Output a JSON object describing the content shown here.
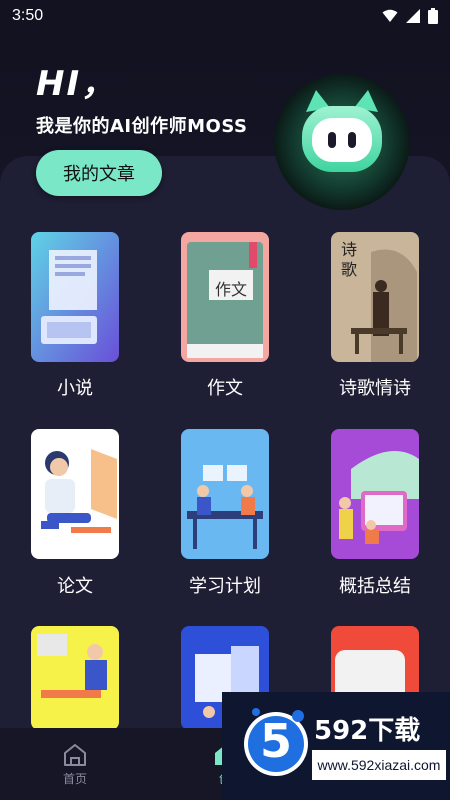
{
  "status_bar": {
    "time": "3:50",
    "icons": [
      "wifi-icon",
      "signal-icon",
      "battery-icon"
    ]
  },
  "header": {
    "greeting": "HI，",
    "intro": "我是你的AI创作师MOSS",
    "articles_button": "我的文章",
    "avatar_icon": "robot-avatar-icon"
  },
  "categories": [
    {
      "label": "小说"
    },
    {
      "label": "作文",
      "cover_text": "作文"
    },
    {
      "label": "诗歌情诗",
      "cover_text": "诗歌"
    },
    {
      "label": "论文"
    },
    {
      "label": "学习计划"
    },
    {
      "label": "概括总结"
    }
  ],
  "tabbar": {
    "home_label": "首页",
    "create_label_visible": "创",
    "home_icon": "home-icon",
    "create_icon": "create-icon"
  },
  "watermark": {
    "logo_text": "5",
    "title": "592下载",
    "url": "www.592xiazai.com"
  },
  "colors": {
    "accent": "#7ae8c6",
    "background": "#0f0f1c",
    "panel": "#1e1e34"
  }
}
